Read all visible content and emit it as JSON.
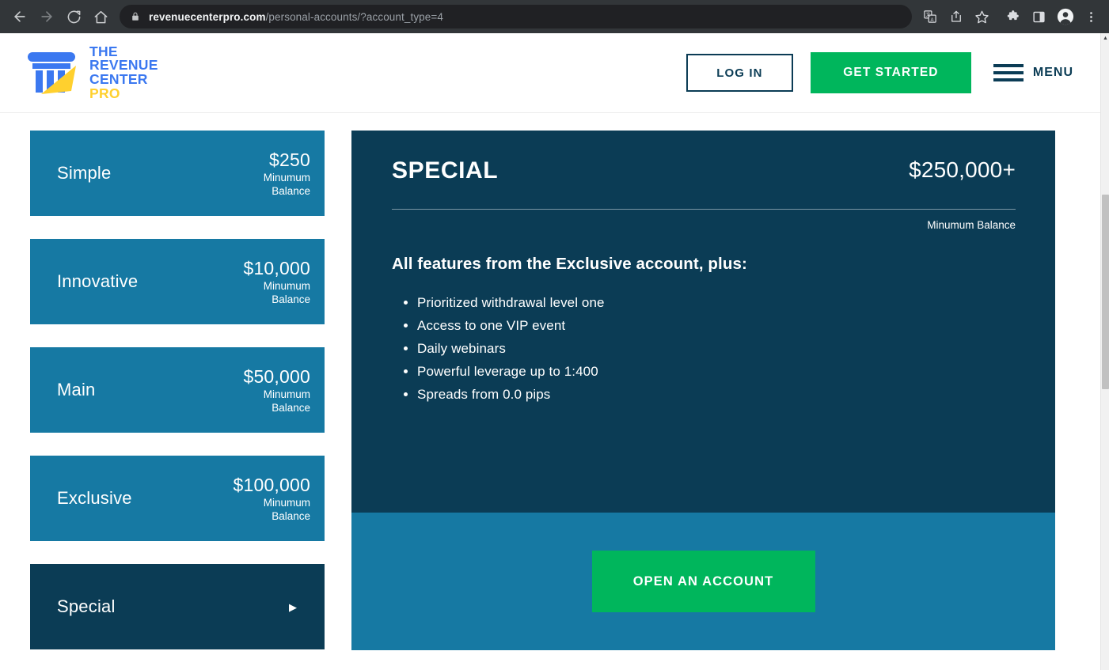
{
  "browser": {
    "back_icon": "back-arrow-icon",
    "forward_icon": "forward-arrow-icon",
    "reload_icon": "reload-icon",
    "home_icon": "home-icon",
    "lock_icon": "lock-icon",
    "url_domain": "revenuecenterpro.com",
    "url_path": "/personal-accounts/?account_type=4",
    "toolbar_icons": [
      "translate-icon",
      "share-icon",
      "bookmark-star-icon",
      "extensions-puzzle-icon",
      "side-panel-icon",
      "profile-avatar-icon",
      "chrome-menu-icon"
    ]
  },
  "header": {
    "logo": {
      "line1": "THE",
      "line2": "REVENUE",
      "line3": "CENTER",
      "line4": "PRO",
      "mark_name": "column-pillar-logo-icon",
      "blue": "#3B78F0",
      "yellow": "#FFD02E"
    },
    "login_label": "LOG IN",
    "get_started_label": "GET STARTED",
    "menu_label": "MENU"
  },
  "accounts": [
    {
      "name": "Simple",
      "price": "$250",
      "sub": "Minumum Balance",
      "active": false
    },
    {
      "name": "Innovative",
      "price": "$10,000",
      "sub": "Minumum Balance",
      "active": false
    },
    {
      "name": "Main",
      "price": "$50,000",
      "sub": "Minumum Balance",
      "active": false
    },
    {
      "name": "Exclusive",
      "price": "$100,000",
      "sub": "Minumum Balance",
      "active": false
    },
    {
      "name": "Special",
      "price": "",
      "sub": "",
      "active": true
    }
  ],
  "detail": {
    "title": "SPECIAL",
    "price": "$250,000+",
    "min_label": "Minumum Balance",
    "lead": "All features from the Exclusive account, plus:",
    "features": [
      "Prioritized withdrawal level one",
      "Access to one VIP event",
      "Daily webinars",
      "Powerful leverage up to 1:400",
      "Spreads from 0.0 pips"
    ],
    "cta_label": "OPEN AN ACCOUNT"
  },
  "colors": {
    "card_blue": "#1679A3",
    "navy": "#0B3C55",
    "green": "#00B65C"
  },
  "scrollbar": {
    "arrow": "▲"
  }
}
